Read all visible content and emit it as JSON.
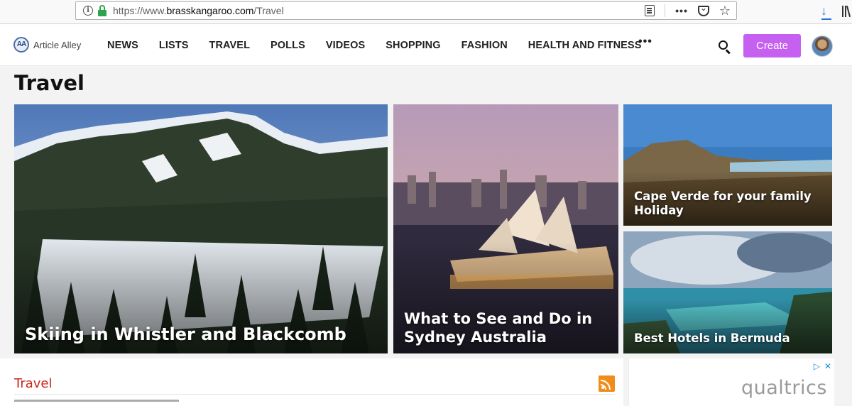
{
  "browser": {
    "url_prefix": "https://www.",
    "url_domain": "brasskangaroo.com",
    "url_path": "/Travel"
  },
  "header": {
    "logo_mark": "AA",
    "logo_text": "Article Alley",
    "nav": [
      {
        "label": "NEWS"
      },
      {
        "label": "LISTS"
      },
      {
        "label": "TRAVEL"
      },
      {
        "label": "POLLS"
      },
      {
        "label": "VIDEOS"
      },
      {
        "label": "SHOPPING"
      },
      {
        "label": "FASHION"
      },
      {
        "label": "HEALTH AND FITNESS"
      }
    ],
    "more": "•••",
    "create_label": "Create"
  },
  "page": {
    "title": "Travel"
  },
  "features": [
    {
      "title": "Skiing in Whistler and Blackcomb"
    },
    {
      "title": "What to See and Do in Sydney Australia"
    },
    {
      "title": "Cape Verde for your family Holiday"
    },
    {
      "title": "Best Hotels in Bermuda"
    }
  ],
  "section": {
    "title": "Travel"
  },
  "ad": {
    "brand": "qualtrics"
  },
  "colors": {
    "create_button": "#c560f0",
    "section_title": "#c8261c",
    "rss": "#f08c1a",
    "lock": "#2ea44f"
  }
}
